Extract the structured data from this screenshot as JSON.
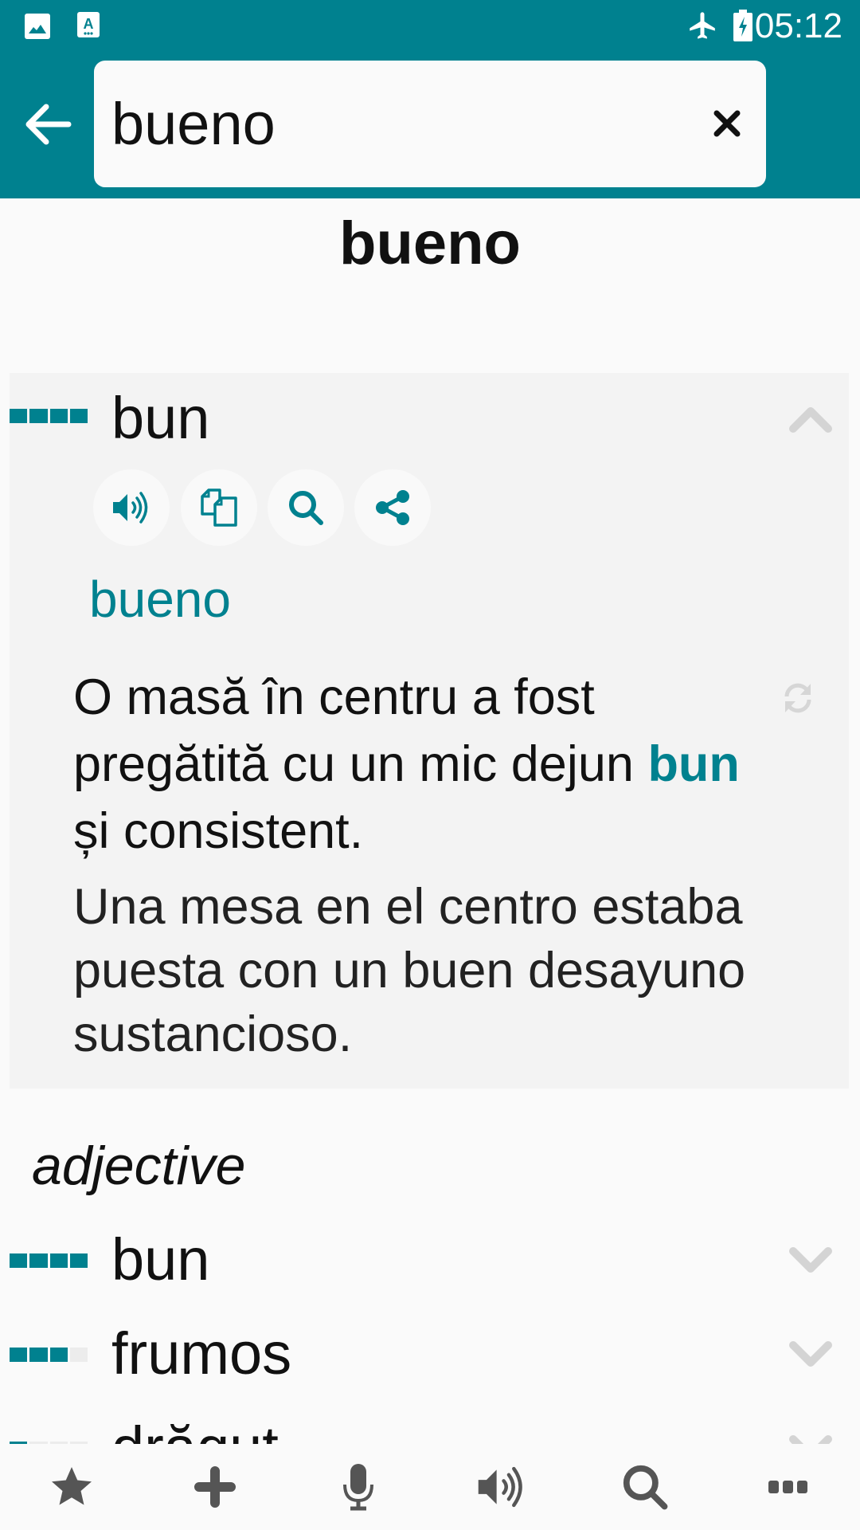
{
  "status_bar": {
    "time": "05:12",
    "left_icons": [
      "image-notification-icon",
      "keyboard-notification-icon"
    ],
    "right_icons": [
      "airplane-mode-icon",
      "battery-charging-icon"
    ]
  },
  "header": {
    "back_icon": "arrow-left-icon",
    "search_value": "bueno",
    "search_placeholder": "",
    "clear_icon": "close-icon"
  },
  "entry": {
    "title": "bueno",
    "accent_color": "#00818f",
    "expanded_translation": {
      "word": "bun",
      "frequency": 4,
      "frequency_max": 4,
      "actions": [
        {
          "name": "speak",
          "icon": "speaker-icon"
        },
        {
          "name": "copy",
          "icon": "copy-icon"
        },
        {
          "name": "search",
          "icon": "search-icon"
        },
        {
          "name": "share",
          "icon": "share-icon"
        }
      ],
      "source_word": "bueno",
      "example_ro_before": "O masă în centru a fost pregătită cu un mic dejun ",
      "example_ro_highlight": "bun",
      "example_ro_after": " și consistent.",
      "example_es": "Una mesa en el centro estaba puesta con un buen desayuno sustancioso."
    },
    "part_of_speech": "adjective",
    "translations": [
      {
        "word": "bun",
        "frequency": 4,
        "frequency_max": 4
      },
      {
        "word": "frumos",
        "frequency": 3,
        "frequency_max": 4
      },
      {
        "word": "drăguț",
        "frequency": 1,
        "frequency_max": 4
      }
    ]
  },
  "bottom_nav": [
    {
      "name": "favorites",
      "icon": "star-icon"
    },
    {
      "name": "add",
      "icon": "plus-icon"
    },
    {
      "name": "voice",
      "icon": "microphone-icon"
    },
    {
      "name": "speak",
      "icon": "speaker-icon"
    },
    {
      "name": "search",
      "icon": "search-icon"
    },
    {
      "name": "more",
      "icon": "more-icon"
    }
  ]
}
